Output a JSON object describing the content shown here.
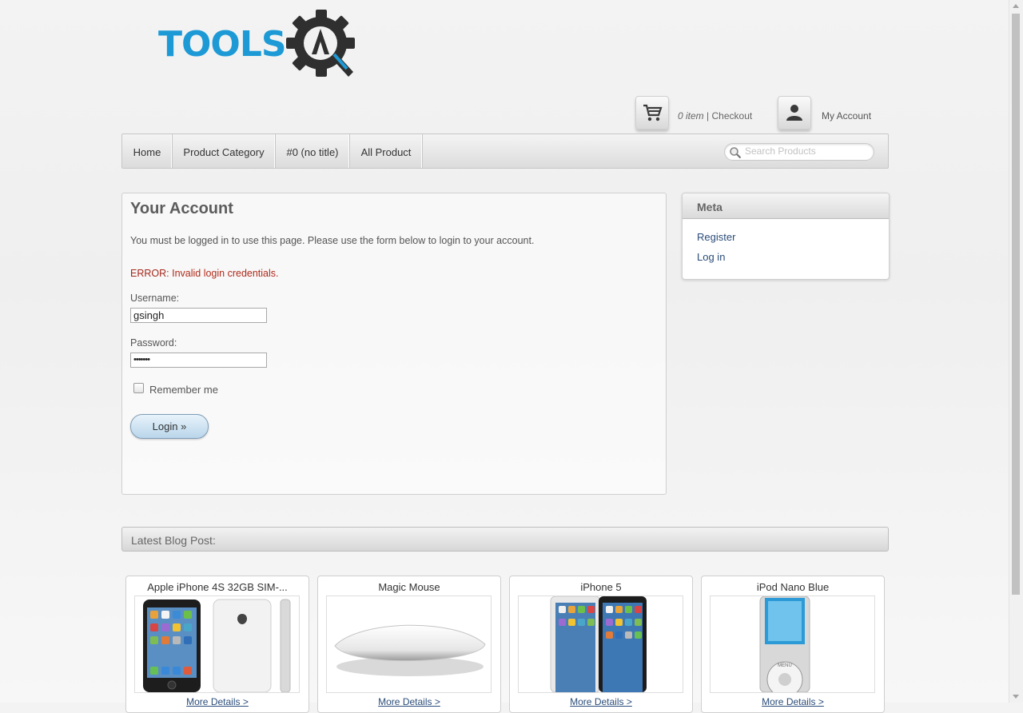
{
  "brand": {
    "logo_text": "TOOLS",
    "logo_icon": "gear-a-logo-icon"
  },
  "header": {
    "cart_icon": "cart-icon",
    "cart_count": "0 item",
    "cart_sep": "|",
    "checkout_label": "Checkout",
    "account_icon": "user-icon",
    "account_label": "My Account"
  },
  "nav": {
    "items": [
      {
        "label": "Home"
      },
      {
        "label": "Product Category"
      },
      {
        "label": "#0 (no title)"
      },
      {
        "label": "All Product"
      }
    ],
    "search_placeholder": "Search Products",
    "search_icon": "magnifier-icon"
  },
  "account": {
    "title": "Your Account",
    "notice": "You must be logged in to use this page. Please use the form below to login to your account.",
    "error_prefix": "ERROR",
    "error_text": ": Invalid login credentials.",
    "username_label": "Username:",
    "username_value": "gsingh",
    "password_label": "Password:",
    "password_value": "•••••••",
    "remember_label": "Remember me",
    "remember_checked": false,
    "login_label": "Login »"
  },
  "meta": {
    "title": "Meta",
    "links": [
      {
        "label": "Register"
      },
      {
        "label": "Log in"
      }
    ]
  },
  "blog": {
    "title": "Latest Blog Post:"
  },
  "products": [
    {
      "name": "Apple iPhone 4S 32GB SIM-...",
      "more": "More Details >",
      "image": "iphone-4s-image"
    },
    {
      "name": "Magic Mouse",
      "more": "More Details >",
      "image": "magic-mouse-image"
    },
    {
      "name": "iPhone 5",
      "more": "More Details >",
      "image": "iphone-5-image"
    },
    {
      "name": "iPod Nano Blue",
      "more": "More Details >",
      "image": "ipod-nano-image"
    }
  ],
  "colors": {
    "brand_blue": "#1d9ad6",
    "error_red": "#b02a1a",
    "link_blue": "#2b4d7a"
  }
}
